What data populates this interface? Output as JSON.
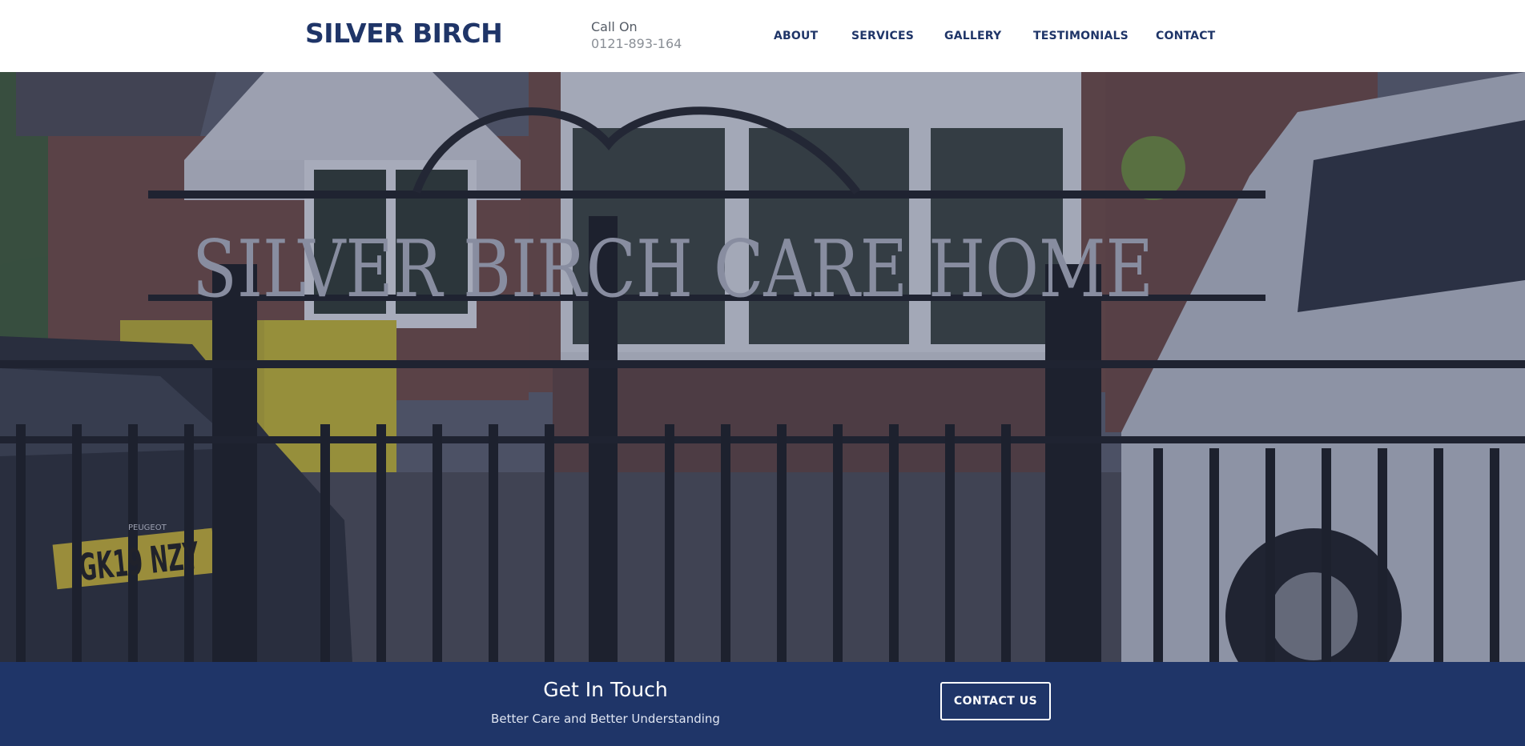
{
  "header": {
    "logo": "SILVER BIRCH",
    "call_label": "Call On",
    "phone": "0121-893-164",
    "nav": [
      {
        "label": "ABOUT"
      },
      {
        "label": "SERVICES"
      },
      {
        "label": "GALLERY"
      },
      {
        "label": "TESTIMONIALS"
      },
      {
        "label": "CONTACT"
      }
    ]
  },
  "hero": {
    "sign_text": "SILVER BIRCH CARE HOME",
    "plate_text": "GK19 NZY",
    "car_badge": "PEUGEOT"
  },
  "cta": {
    "title": "Get In Touch",
    "subtitle": "Better Care and Better Understanding",
    "button_label": "CONTACT US"
  },
  "colors": {
    "brand": "#1f3568",
    "cta_background": "#1f3568",
    "text_muted": "#8a8f96"
  }
}
